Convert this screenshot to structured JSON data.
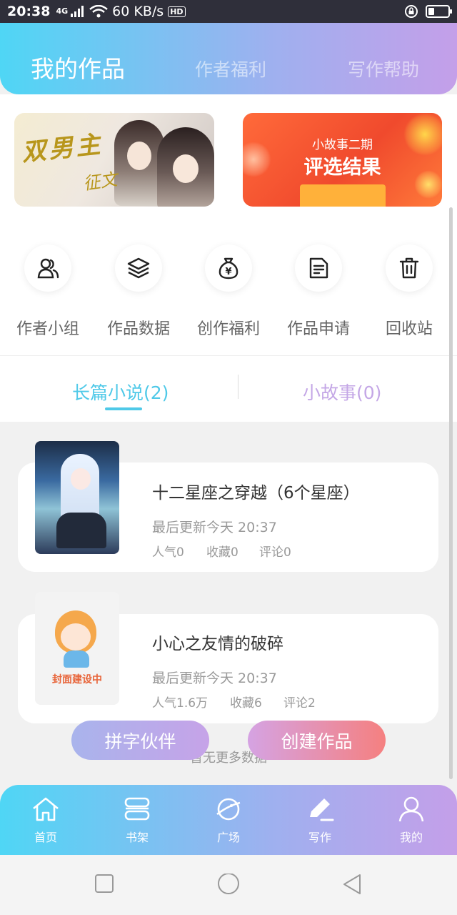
{
  "status_bar": {
    "time": "20:38",
    "network": "4G",
    "speed": "60 KB/s",
    "hd": "HD",
    "battery_level": 0.3
  },
  "header": {
    "tabs": [
      {
        "label": "我的作品",
        "active": true
      },
      {
        "label": "作者福利",
        "active": false
      },
      {
        "label": "写作帮助",
        "active": false
      }
    ]
  },
  "banners": [
    {
      "title": "双男主",
      "subtitle": "征文"
    },
    {
      "line1": "小故事二期",
      "line2": "评选结果"
    }
  ],
  "actions": [
    {
      "label": "作者小组",
      "icon": "users-icon"
    },
    {
      "label": "作品数据",
      "icon": "layers-icon"
    },
    {
      "label": "创作福利",
      "icon": "money-bag-icon"
    },
    {
      "label": "作品申请",
      "icon": "document-icon"
    },
    {
      "label": "回收站",
      "icon": "trash-icon"
    }
  ],
  "subtabs": [
    {
      "label": "长篇小说(2)",
      "active": true
    },
    {
      "label": "小故事(0)",
      "active": false
    }
  ],
  "works": [
    {
      "title": "十二星座之穿越（6个星座）",
      "updated": "最后更新今天 20:37",
      "popularity": "人气0",
      "favorites": "收藏0",
      "comments": "评论0",
      "cover_text": ""
    },
    {
      "title": "小心之友情的破碎",
      "updated": "最后更新今天 20:37",
      "popularity": "人气1.6万",
      "favorites": "收藏6",
      "comments": "评论2",
      "cover_text": "封面建设中"
    }
  ],
  "no_more": "暂无更多数据",
  "buttons": {
    "partner": "拼字伙伴",
    "create": "创建作品"
  },
  "bottom_nav": [
    {
      "label": "首页",
      "icon": "home-icon"
    },
    {
      "label": "书架",
      "icon": "bookshelf-icon"
    },
    {
      "label": "广场",
      "icon": "planet-icon"
    },
    {
      "label": "写作",
      "icon": "pen-icon"
    },
    {
      "label": "我的",
      "icon": "user-icon"
    }
  ],
  "colors": {
    "accent_cyan": "#4fc9e8",
    "accent_purple": "#c4a7e6",
    "gradient_start": "#4fd6f5",
    "gradient_end": "#c49fe9"
  }
}
